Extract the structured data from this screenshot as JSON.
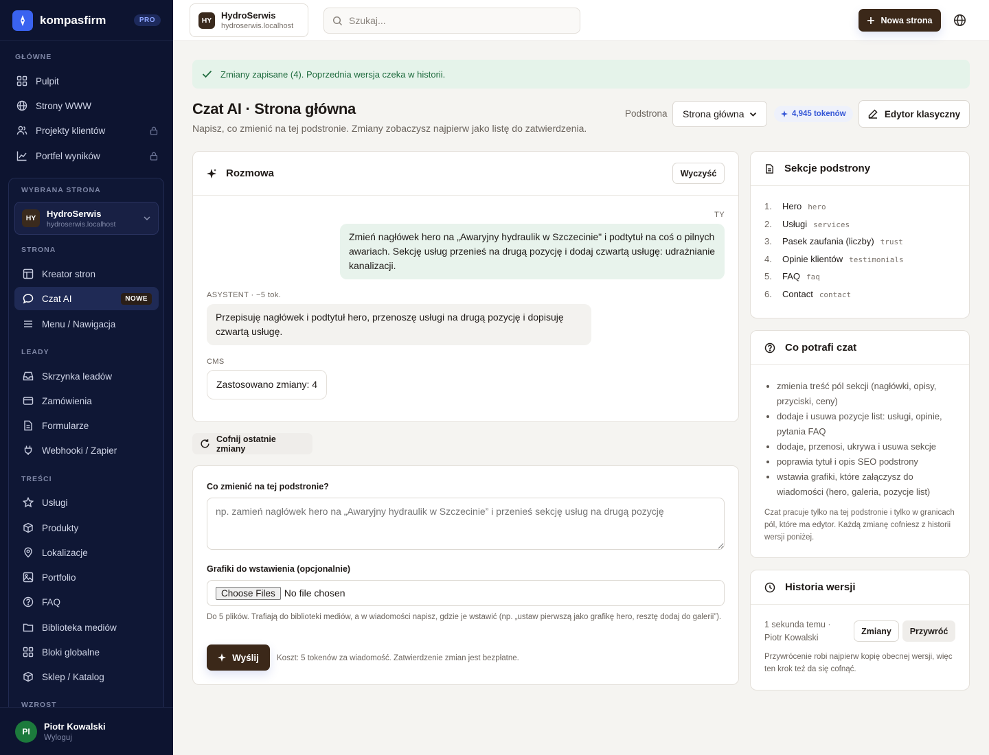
{
  "brand": {
    "name": "kompasfirm",
    "badge": "PRO"
  },
  "sidebar": {
    "sections": {
      "main": "GŁÓWNE",
      "site": "WYBRANA STRONA",
      "page": "STRONA",
      "leads": "LEADY",
      "content": "TREŚCI",
      "growth": "WZROST"
    },
    "main_items": [
      {
        "label": "Pulpit"
      },
      {
        "label": "Strony WWW"
      },
      {
        "label": "Projekty klientów"
      },
      {
        "label": "Portfel wyników"
      }
    ],
    "site_card": {
      "initials": "HY",
      "name": "HydroSerwis",
      "domain": "hydroserwis.localhost"
    },
    "page_items": [
      {
        "label": "Kreator stron"
      },
      {
        "label": "Czat AI",
        "badge": "NOWE"
      },
      {
        "label": "Menu / Nawigacja"
      }
    ],
    "lead_items": [
      {
        "label": "Skrzynka leadów"
      },
      {
        "label": "Zamówienia"
      },
      {
        "label": "Formularze"
      },
      {
        "label": "Webhooki / Zapier"
      }
    ],
    "content_items": [
      {
        "label": "Usługi"
      },
      {
        "label": "Produkty"
      },
      {
        "label": "Lokalizacje"
      },
      {
        "label": "Portfolio"
      },
      {
        "label": "FAQ"
      },
      {
        "label": "Biblioteka mediów"
      },
      {
        "label": "Bloki globalne"
      },
      {
        "label": "Sklep / Katalog"
      }
    ],
    "user": {
      "initials": "PI",
      "name": "Piotr Kowalski",
      "logout": "Wyloguj"
    }
  },
  "topbar": {
    "site": {
      "initials": "HY",
      "name": "HydroSerwis",
      "domain": "hydroserwis.localhost"
    },
    "search_placeholder": "Szukaj...",
    "new_page_label": "Nowa strona"
  },
  "alert": {
    "text": "Zmiany zapisane (4). Poprzednia wersja czeka w historii."
  },
  "page": {
    "title": "Czat AI · Strona główna",
    "subtitle": "Napisz, co zmienić na tej podstronie. Zmiany zobaczysz najpierw jako listę do zatwierdzenia.",
    "subpage_label": "Podstrona",
    "subpage_selected": "Strona główna",
    "tokens": "4,945 tokenów",
    "classic_editor_label": "Edytor klasyczny"
  },
  "chat": {
    "title": "Rozmowa",
    "clear_label": "Wyczyść",
    "user_label": "TY",
    "user_message": "Zmień nagłówek hero na „Awaryjny hydraulik w Szczecinie\" i podtytuł na coś o pilnych awariach. Sekcję usług przenieś na drugą pozycję i dodaj czwartą usługę: udrażnianie kanalizacji.",
    "assistant_label": "ASYSTENT · −5 tok.",
    "assistant_message": "Przepisuję nagłówek i podtytuł hero, przenoszę usługi na drugą pozycję i dopisuję czwartą usługę.",
    "cms_label": "CMS",
    "cms_message": "Zastosowano zmiany: 4"
  },
  "undo_label": "Cofnij ostatnie zmiany",
  "form": {
    "question_label": "Co zmienić na tej podstronie?",
    "textarea_placeholder": "np. zamień nagłówek hero na „Awaryjny hydraulik w Szczecinie” i przenieś sekcję usług na drugą pozycję",
    "files_label": "Grafiki do wstawienia (opcjonalnie)",
    "choose_files": "Choose Files",
    "no_file": "No file chosen",
    "files_hint": "Do 5 plików. Trafiają do biblioteki mediów, a w wiadomości napisz, gdzie je wstawić (np. „ustaw pierwszą jako grafikę hero, resztę dodaj do galerii”).",
    "send_label": "Wyślij",
    "cost_note": "Koszt: 5 tokenów za wiadomość. Zatwierdzenie zmian jest bezpłatne."
  },
  "sections_card": {
    "title": "Sekcje podstrony",
    "items": [
      {
        "num": "1.",
        "name": "Hero",
        "key": "hero"
      },
      {
        "num": "2.",
        "name": "Usługi",
        "key": "services"
      },
      {
        "num": "3.",
        "name": "Pasek zaufania (liczby)",
        "key": "trust"
      },
      {
        "num": "4.",
        "name": "Opinie klientów",
        "key": "testimonials"
      },
      {
        "num": "5.",
        "name": "FAQ",
        "key": "faq"
      },
      {
        "num": "6.",
        "name": "Contact",
        "key": "contact"
      }
    ]
  },
  "capabilities_card": {
    "title": "Co potrafi czat",
    "items": [
      "zmienia treść pól sekcji (nagłówki, opisy, przyciski, ceny)",
      "dodaje i usuwa pozycje list: usługi, opinie, pytania FAQ",
      "dodaje, przenosi, ukrywa i usuwa sekcje",
      "poprawia tytuł i opis SEO podstrony",
      "wstawia grafiki, które załączysz do wiadomości (hero, galeria, pozycje list)"
    ],
    "note": "Czat pracuje tylko na tej podstronie i tylko w granicach pól, które ma edytor. Każdą zmianę cofniesz z historii wersji poniżej."
  },
  "history_card": {
    "title": "Historia wersji",
    "entry_time": "1 sekunda temu ·",
    "entry_author": "Piotr Kowalski",
    "changes_label": "Zmiany",
    "restore_label": "Przywróć",
    "note": "Przywrócenie robi najpierw kopię obecnej wersji, więc ten krok też da się cofnąć."
  }
}
